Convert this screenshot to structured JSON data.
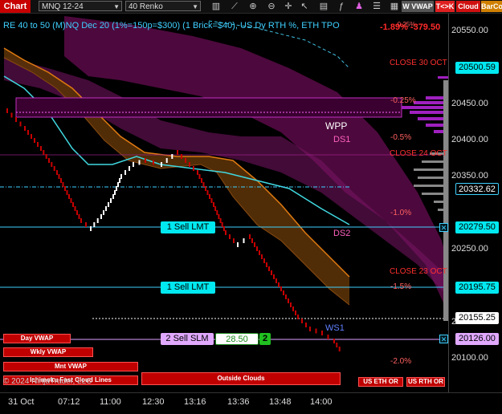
{
  "toolbar": {
    "tab_label": "Chart",
    "instrument": "MNQ 12-24",
    "bar_type": "40 Renko",
    "icons": [
      "bar-chart-icon",
      "ruler-icon",
      "zoom-in-icon",
      "zoom-out-icon",
      "crosshair-icon",
      "pointer-icon",
      "template-icon",
      "indicator-icon",
      "strategy-icon",
      "properties-icon",
      "order-icon",
      "data-box-icon"
    ],
    "wvwap_label": "W VWAP",
    "tk_label": "T<>K",
    "cloud_label": "Cloud",
    "barcolor_label": "BarCo"
  },
  "header": {
    "title": "RE 40 to 50 (M)NQ Dec 20 (1%=150p=$300) (1 Brick=$40), US Dy RTH %, ETH TPO",
    "pnl": "-1.89% -379.50",
    "pct_top": "-0.25%"
  },
  "price_axis": {
    "ticks": [
      "20550.00",
      "20450.00",
      "20400.00",
      "20350.00",
      "20250.00",
      "20150.00",
      "20100.00"
    ],
    "markers": [
      "20500.59",
      "20332.62",
      "20279.50",
      "20195.75",
      "20155.25",
      "20126.00"
    ]
  },
  "time_axis": {
    "ticks": [
      "31 Oct",
      "07:12",
      "11:00",
      "12:30",
      "13:16",
      "13:36",
      "13:48",
      "14:00"
    ]
  },
  "levels": {
    "close_30_oct": "CLOSE 30 OCT",
    "close_24_oct": "CLOSE 24 OCT",
    "close_23_oct": "CLOSE 23 OCT",
    "wpp": "WPP",
    "ds1": "DS1",
    "ds2": "DS2",
    "ws1": "WS1",
    "pcts": [
      "-0.25%",
      "-0.5%",
      "-1.0%",
      "-1.5%",
      "-2.0%"
    ]
  },
  "orders": {
    "sell_lmt_1": "1 Sell LMT",
    "sell_lmt_2": "1 Sell LMT",
    "sell_slm": "2 Sell SLM",
    "slm_price": "28.50",
    "slm_qty": "2"
  },
  "buttons": {
    "day_vwap": "Day VWAP",
    "wkly_vwap": "Wkly VWAP",
    "mnt_vwap": "Mnt VWAP",
    "ichimoku": "Ichimoku Fast Cloud Lines",
    "outside_clouds": "Outside Clouds",
    "us_eth_or": "US ETH OR",
    "us_rth_or": "US RTH OR"
  },
  "copyright": "© 2024 NinjaTrader, LLC",
  "colors": {
    "accent": "#3fd0ff",
    "down": "#c80000",
    "up": "#ffffff",
    "cloud_orange": "#e07a10",
    "cloud_magenta": "#b0168a",
    "pnl_red": "#ff2a2a"
  }
}
